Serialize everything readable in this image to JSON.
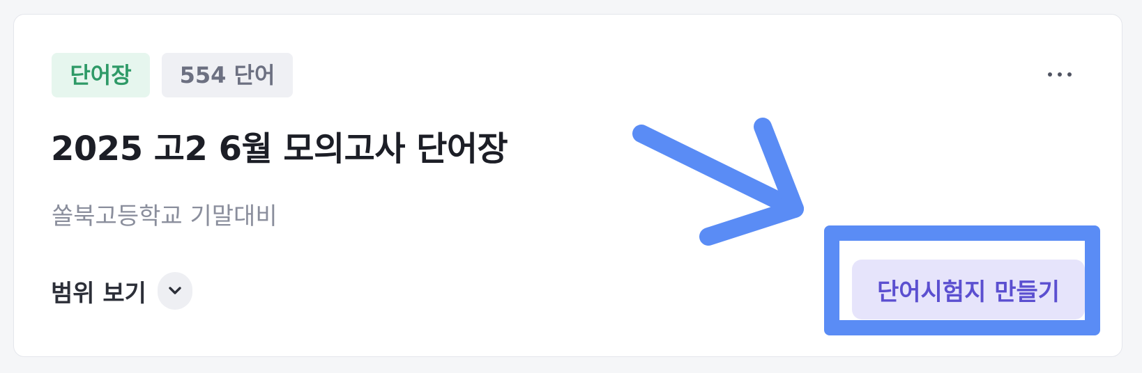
{
  "card": {
    "type_badge": "단어장",
    "count_badge": "554 단어",
    "title": "2025 고2 6월 모의고사 단어장",
    "subtitle": "쏠북고등학교 기말대비",
    "range_label": "범위 보기",
    "quiz_button_label": "단어시험지 만들기"
  },
  "icons": {
    "more": "more-horizontal-icon",
    "range_toggle": "chevron-down-icon",
    "annotation": "arrow-annotation"
  },
  "colors": {
    "type_badge_bg": "#e6f6ee",
    "type_badge_text": "#2e9a67",
    "count_badge_bg": "#eff0f4",
    "count_badge_text": "#6c7081",
    "quiz_button_bg": "#e6e4fb",
    "quiz_button_text": "#5b4fd0",
    "annotation": "#5a8cf5"
  }
}
